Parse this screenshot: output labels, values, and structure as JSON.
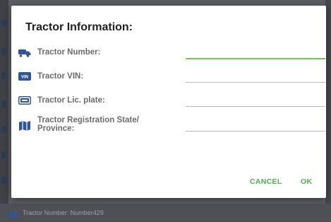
{
  "background": {
    "bottom_row_text": "Tractor Number: Number429"
  },
  "dialog": {
    "title": "Tractor Information:",
    "fields": [
      {
        "label": "Tractor Number:",
        "icon": "truck-icon",
        "value": ""
      },
      {
        "label": "Tractor VIN:",
        "icon": "vin-badge-icon",
        "badge_text": "VIN",
        "value": ""
      },
      {
        "label": "Tractor Lic. plate:",
        "icon": "license-plate-icon",
        "value": ""
      },
      {
        "label_line1": "Tractor Registration State/",
        "label_line2": "Province:",
        "icon": "map-icon",
        "value": ""
      }
    ],
    "cancel_label": "CANCEL",
    "ok_label": "OK"
  },
  "colors": {
    "accent": "#4caf50",
    "icon_blue": "#2f5597",
    "focused_underline": "#7bbf5a"
  }
}
